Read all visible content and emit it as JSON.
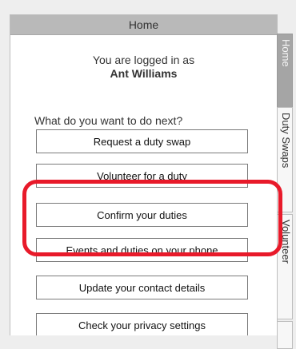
{
  "header": {
    "title": "Home"
  },
  "intro": {
    "logged_in_text": "You are logged in as",
    "user_name": "Ant Williams"
  },
  "prompt": "What do you want to do next?",
  "buttons": [
    {
      "label": "Request a duty swap"
    },
    {
      "label": "Volunteer for a duty"
    },
    {
      "label": "Confirm your duties"
    },
    {
      "label": "Events and duties on your phone"
    },
    {
      "label": "Update your contact details"
    },
    {
      "label": "Check your privacy settings"
    }
  ],
  "tabs": [
    {
      "label": "Home",
      "active": true
    },
    {
      "label": "Duty Swaps",
      "active": false
    },
    {
      "label": "Volunteer",
      "active": false
    }
  ],
  "colors": {
    "highlight": "#e81a2a",
    "header_bg": "#b9b9b9",
    "active_tab": "#a5a5a5"
  }
}
